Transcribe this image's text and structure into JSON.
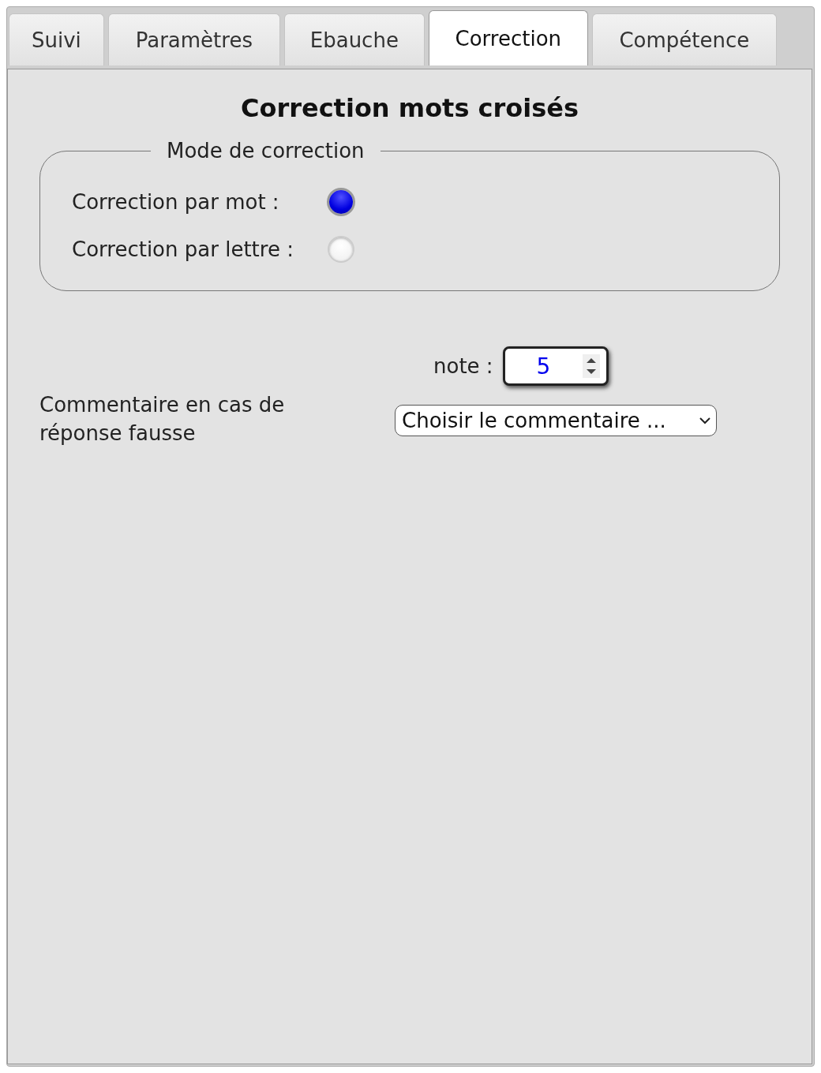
{
  "tabs": [
    {
      "label": "Suivi",
      "selected": false
    },
    {
      "label": "Paramètres",
      "selected": false
    },
    {
      "label": "Ebauche",
      "selected": false
    },
    {
      "label": "Correction",
      "selected": true
    },
    {
      "label": "Compétence",
      "selected": false
    }
  ],
  "title": "Correction mots croisés",
  "correction_mode": {
    "legend": "Mode de correction",
    "options": [
      {
        "label": "Correction par mot :",
        "selected": true
      },
      {
        "label": "Correction par lettre :",
        "selected": false
      }
    ]
  },
  "note": {
    "label": "note :",
    "value": "5"
  },
  "wrong_answer_comment": {
    "label": "Commentaire en cas de réponse fausse",
    "value": "Choisir le commentaire ..."
  }
}
